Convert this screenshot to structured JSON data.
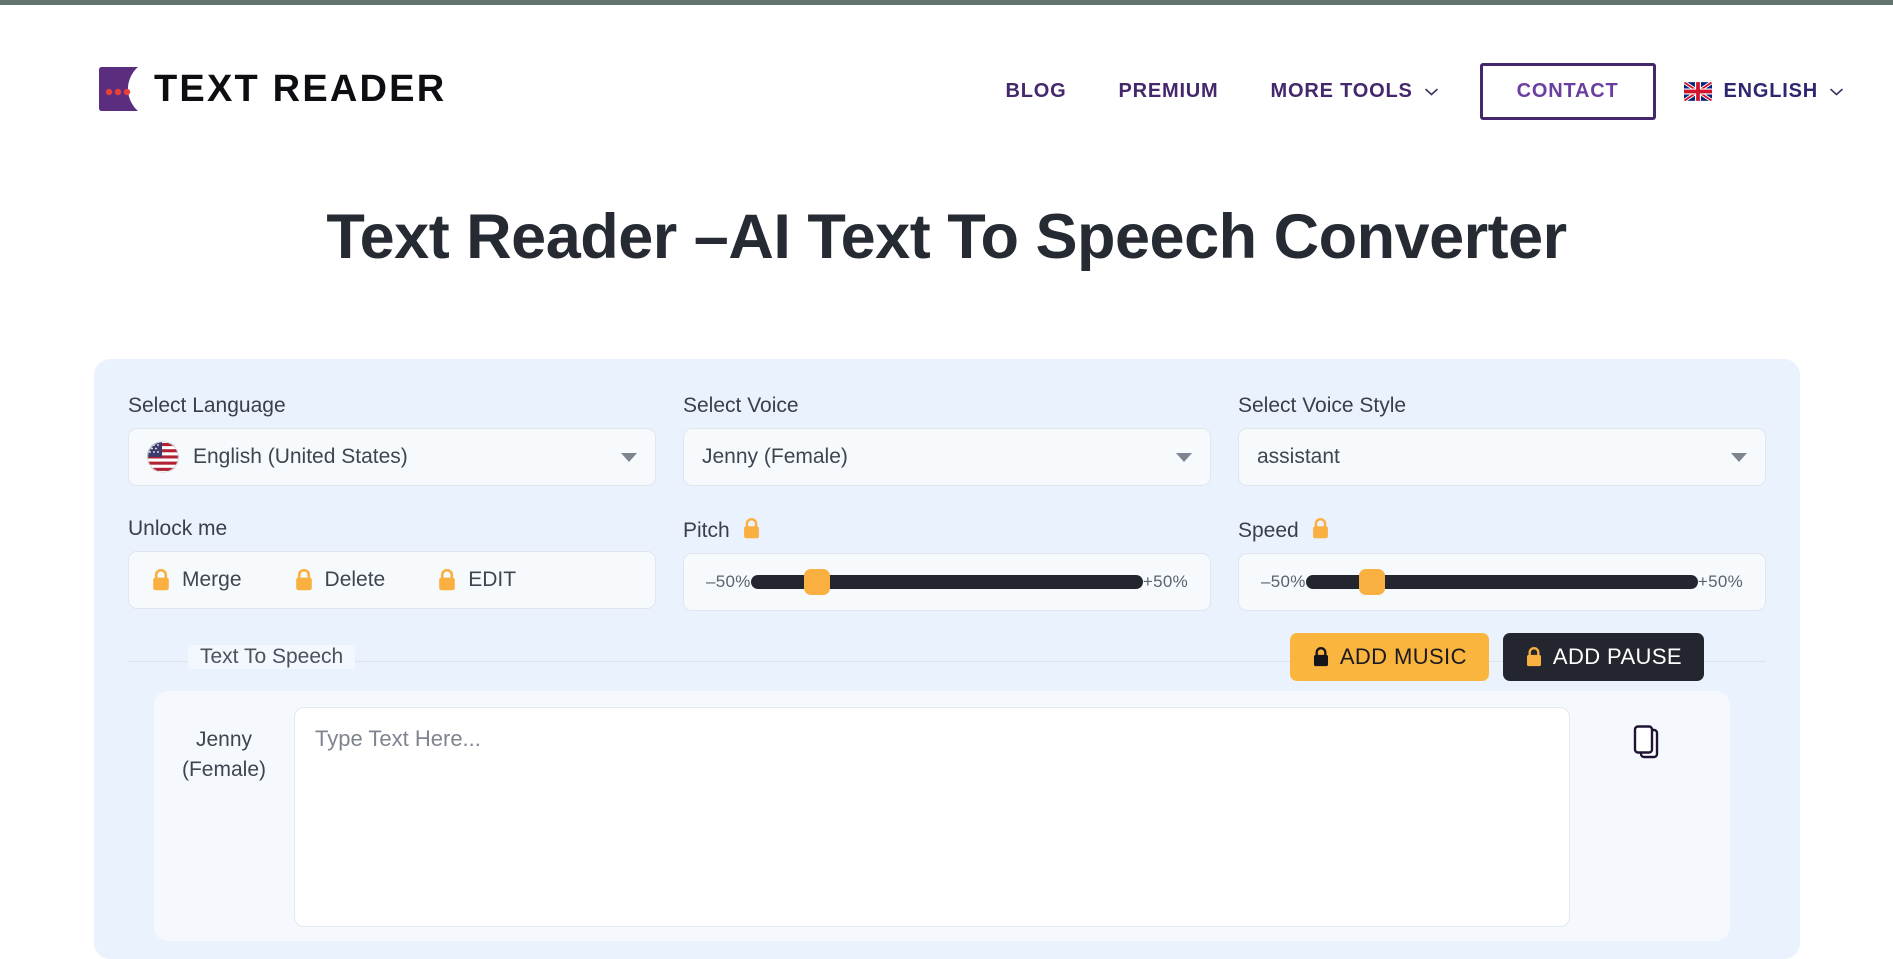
{
  "brand": {
    "name": "TEXT READER",
    "logo_icon": "speech-bubble-logo-icon"
  },
  "nav": {
    "items": [
      {
        "label": "BLOG",
        "has_caret": false
      },
      {
        "label": "PREMIUM",
        "has_caret": false
      },
      {
        "label": "MORE TOOLS",
        "has_caret": true
      }
    ],
    "contact_label": "CONTACT",
    "language": {
      "label": "ENGLISH",
      "flag_icon": "uk-flag-icon",
      "caret_icon": "chevron-down-icon"
    }
  },
  "hero": {
    "title": "Text Reader –AI Text To Speech Converter"
  },
  "controls": {
    "language": {
      "label": "Select Language",
      "value": "English (United States)",
      "flag_icon": "us-flag-icon"
    },
    "voice": {
      "label": "Select Voice",
      "value": "Jenny (Female)"
    },
    "voice_style": {
      "label": "Select Voice Style",
      "value": "assistant"
    },
    "unlock": {
      "label": "Unlock me",
      "items": [
        {
          "label": "Merge",
          "icon": "lock-icon"
        },
        {
          "label": "Delete",
          "icon": "lock-icon"
        },
        {
          "label": "EDIT",
          "icon": "lock-icon"
        }
      ]
    },
    "pitch": {
      "label": "Pitch",
      "lock_icon": "lock-icon",
      "min_label": "–50%",
      "max_label": "+50%",
      "value_percent": 17
    },
    "speed": {
      "label": "Speed",
      "lock_icon": "lock-icon",
      "min_label": "–50%",
      "max_label": "+50%",
      "value_percent": 17
    }
  },
  "tts": {
    "legend": "Text To Speech",
    "add_music_label": "ADD MUSIC",
    "add_pause_label": "ADD PAUSE",
    "voice_tag_line1": "Jenny",
    "voice_tag_line2": "(Female)",
    "textarea_placeholder": "Type Text Here...",
    "textarea_value": "",
    "copy_icon": "copy-icon"
  },
  "colors": {
    "brand_purple": "#44286b",
    "accent_amber": "#fab53f",
    "panel_blue": "#eaf2fd",
    "dark": "#23262e"
  }
}
